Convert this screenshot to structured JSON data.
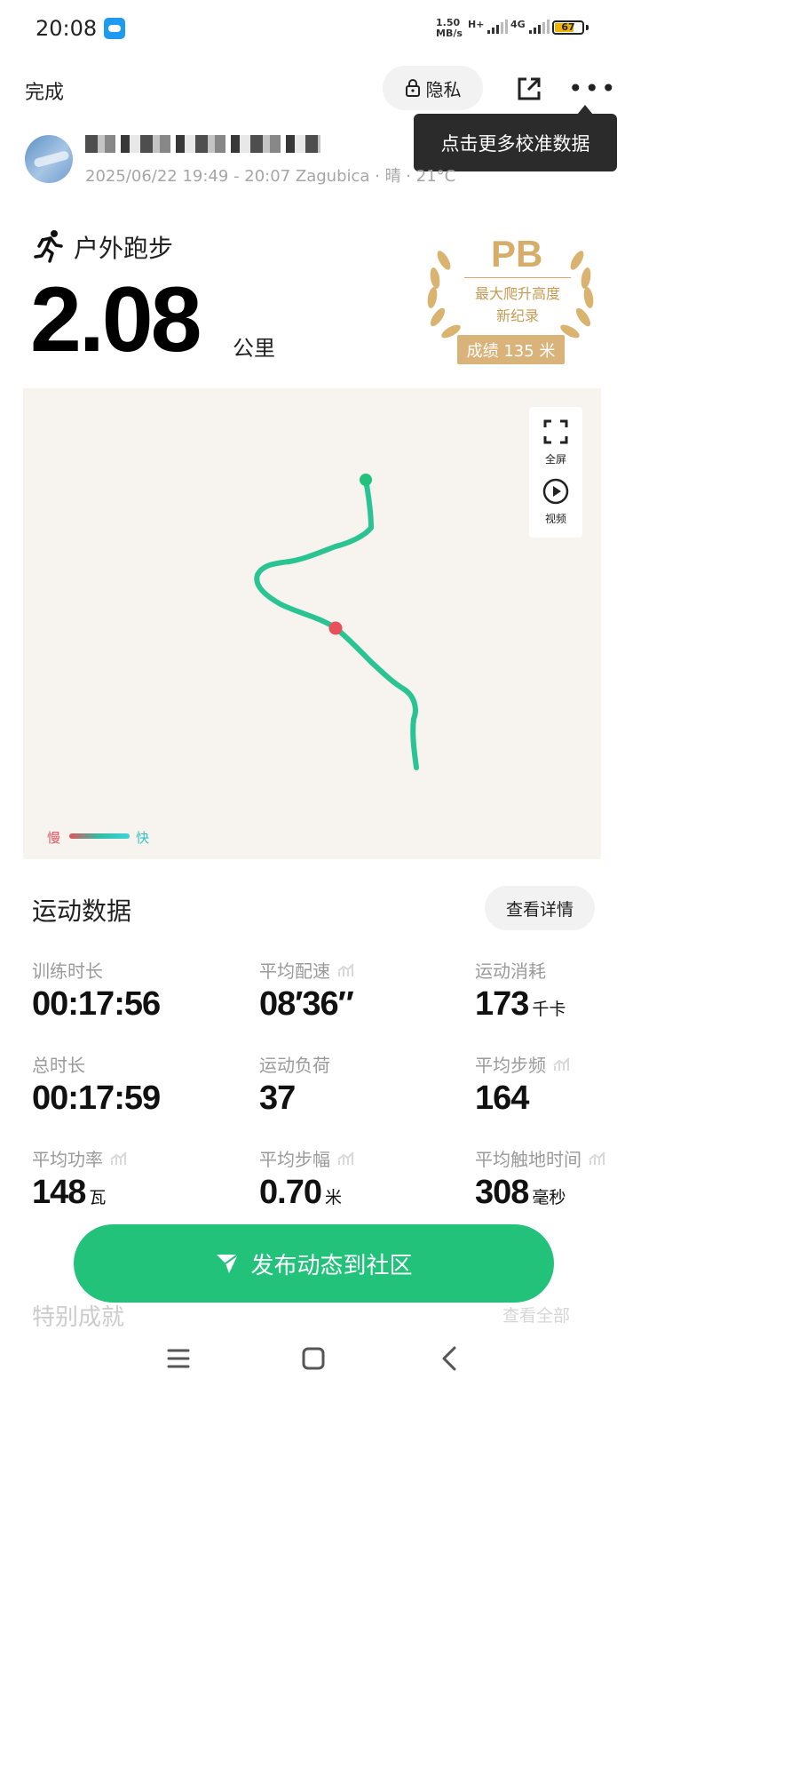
{
  "status_bar": {
    "time": "20:08",
    "net_speed_value": "1.50",
    "net_speed_unit": "MB/s",
    "signal_1": "H+",
    "signal_2": "4G",
    "battery": "67"
  },
  "header": {
    "done_label": "完成",
    "privacy_label": "隐私",
    "tooltip": "点击更多校准数据",
    "icons": {
      "privacy": "lock-icon",
      "share": "share-icon",
      "more": "more-dots-icon"
    }
  },
  "profile": {
    "meta": "2025/06/22 19:49 - 20:07 Zagubica · 晴 · 21°C"
  },
  "activity": {
    "type": "户外跑步",
    "distance": "2.08",
    "distance_unit": "公里"
  },
  "badge": {
    "title": "PB",
    "line1": "最大爬升高度",
    "line2": "新纪录",
    "score": "成绩 135 米"
  },
  "map": {
    "fullscreen_label": "全屏",
    "video_label": "视频",
    "legend_slow": "慢",
    "legend_fast": "快",
    "colors": {
      "route": "#28c490",
      "start": "#22c27b",
      "marker": "#e8505b"
    }
  },
  "stats": {
    "title": "运动数据",
    "details_label": "查看详情",
    "items": [
      {
        "label": "训练时长",
        "value": "00:17:56",
        "unit": ""
      },
      {
        "label": "平均配速",
        "value": "08′36″",
        "unit": ""
      },
      {
        "label": "运动消耗",
        "value": "173",
        "unit": "千卡"
      },
      {
        "label": "总时长",
        "value": "00:17:59",
        "unit": ""
      },
      {
        "label": "运动负荷",
        "value": "37",
        "unit": ""
      },
      {
        "label": "平均步频",
        "value": "164",
        "unit": ""
      },
      {
        "label": "平均功率",
        "value": "148",
        "unit": "瓦"
      },
      {
        "label": "平均步幅",
        "value": "0.70",
        "unit": "米"
      },
      {
        "label": "平均触地时间",
        "value": "308",
        "unit": "毫秒"
      }
    ]
  },
  "footer": {
    "publish_label": "发布动态到社区",
    "ghost_left": "特别成就",
    "ghost_right": "查看全部"
  }
}
